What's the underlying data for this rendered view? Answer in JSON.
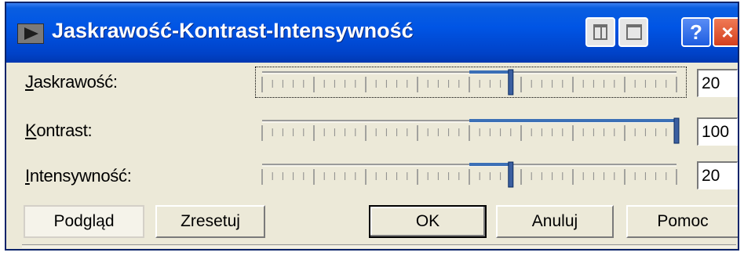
{
  "window": {
    "title": "Jaskrawość-Kontrast-Intensywność"
  },
  "title_buttons": {
    "help_glyph": "?",
    "close_glyph": "×"
  },
  "rows": [
    {
      "label": "Jaskrawość:",
      "accel": "J",
      "value": "20",
      "min": -100,
      "max": 100,
      "focused": true
    },
    {
      "label": "Kontrast:",
      "accel": "K",
      "value": "100",
      "min": -100,
      "max": 100,
      "focused": false
    },
    {
      "label": "Intensywność:",
      "accel": "I",
      "value": "20",
      "min": -100,
      "max": 100,
      "focused": false
    }
  ],
  "buttons": {
    "preview": "Podgląd",
    "reset": "Zresetuj",
    "ok": "OK",
    "cancel": "Anuluj",
    "help": "Pomoc"
  },
  "colors": {
    "titlebar": "#0055e5",
    "slider_fill": "#3b6fb6",
    "face": "#ece9d8"
  },
  "icons": {
    "app": "play-triangle-icon",
    "tile": "tile-windows-icon",
    "maximize": "maximize-icon",
    "help": "help-icon",
    "close": "close-icon"
  }
}
